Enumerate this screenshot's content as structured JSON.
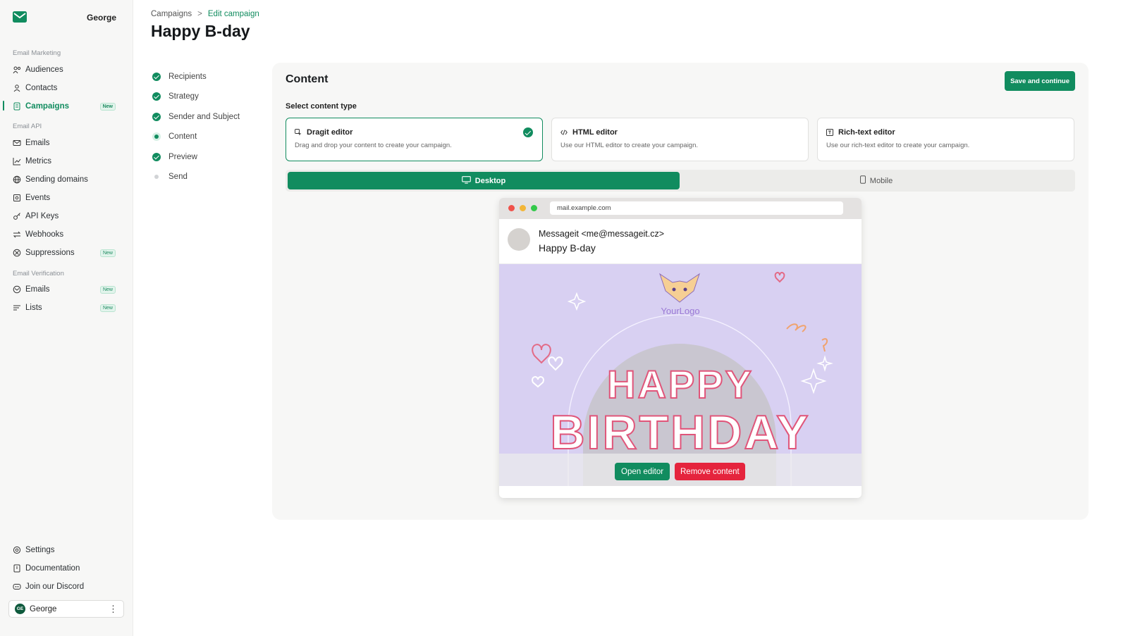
{
  "brand": {
    "user_name": "George",
    "logo_icon": "envelope-icon",
    "accent": "#118c5f"
  },
  "sidebar": {
    "sections": [
      {
        "label": "Email Marketing"
      },
      {
        "label": "Email API"
      },
      {
        "label": "Email Verification"
      }
    ],
    "items": [
      {
        "label": "Audiences",
        "icon": "audiences-icon",
        "badge": ""
      },
      {
        "label": "Contacts",
        "icon": "contacts-icon",
        "badge": ""
      },
      {
        "label": "Campaigns",
        "icon": "campaigns-icon",
        "badge": "New"
      },
      {
        "label": "Emails",
        "icon": "mail-icon",
        "badge": ""
      },
      {
        "label": "Metrics",
        "icon": "chart-icon",
        "badge": ""
      },
      {
        "label": "Sending domains",
        "icon": "globe-icon",
        "badge": ""
      },
      {
        "label": "Events",
        "icon": "events-icon",
        "badge": ""
      },
      {
        "label": "API Keys",
        "icon": "key-icon",
        "badge": ""
      },
      {
        "label": "Webhooks",
        "icon": "webhooks-icon",
        "badge": ""
      },
      {
        "label": "Suppressions",
        "icon": "ban-icon",
        "badge": "New"
      },
      {
        "label": "Emails",
        "icon": "mail-check-icon",
        "badge": "New"
      },
      {
        "label": "Lists",
        "icon": "list-icon",
        "badge": "New"
      }
    ],
    "footer_items": [
      {
        "label": "Settings",
        "icon": "gear-icon"
      },
      {
        "label": "Documentation",
        "icon": "book-icon"
      },
      {
        "label": "Join our Discord",
        "icon": "discord-icon"
      }
    ],
    "user": {
      "initials": "GE",
      "name": "George",
      "menu_icon": "kebab-icon"
    }
  },
  "header": {
    "breadcrumb": {
      "root": "Campaigns",
      "separator": ">",
      "current": "Edit campaign"
    },
    "title": "Happy B-day"
  },
  "steps": [
    {
      "label": "Recipients",
      "state": "done"
    },
    {
      "label": "Strategy",
      "state": "done"
    },
    {
      "label": "Sender and Subject",
      "state": "done"
    },
    {
      "label": "Content",
      "state": "current"
    },
    {
      "label": "Preview",
      "state": "done"
    },
    {
      "label": "Send",
      "state": "pending"
    }
  ],
  "content": {
    "title": "Content",
    "save_label": "Save and continue",
    "select_label": "Select content type",
    "types": [
      {
        "title": "Dragit editor",
        "desc": "Drag and drop your content to create your campaign.",
        "selected": true,
        "icon": "drag-icon"
      },
      {
        "title": "HTML editor",
        "desc": "Use our HTML editor to create your campaign.",
        "selected": false,
        "icon": "code-icon"
      },
      {
        "title": "Rich-text editor",
        "desc": "Use our rich-text editor to create your campaign.",
        "selected": false,
        "icon": "richtext-icon"
      }
    ],
    "view_toggle": {
      "desktop": "Desktop",
      "mobile": "Mobile",
      "active": "desktop"
    }
  },
  "preview": {
    "url": "mail.example.com",
    "sender": "Messageit <me@messageit.cz>",
    "subject": "Happy B-day",
    "logo_text": "YourLogo",
    "headline_1": "HAPPY",
    "headline_2": "BIRTHDAY",
    "open_label": "Open editor",
    "remove_label": "Remove content",
    "colors": {
      "body_bg": "#d8d0f2",
      "headline_stroke": "#e0557a",
      "remove": "#e5243d"
    }
  }
}
